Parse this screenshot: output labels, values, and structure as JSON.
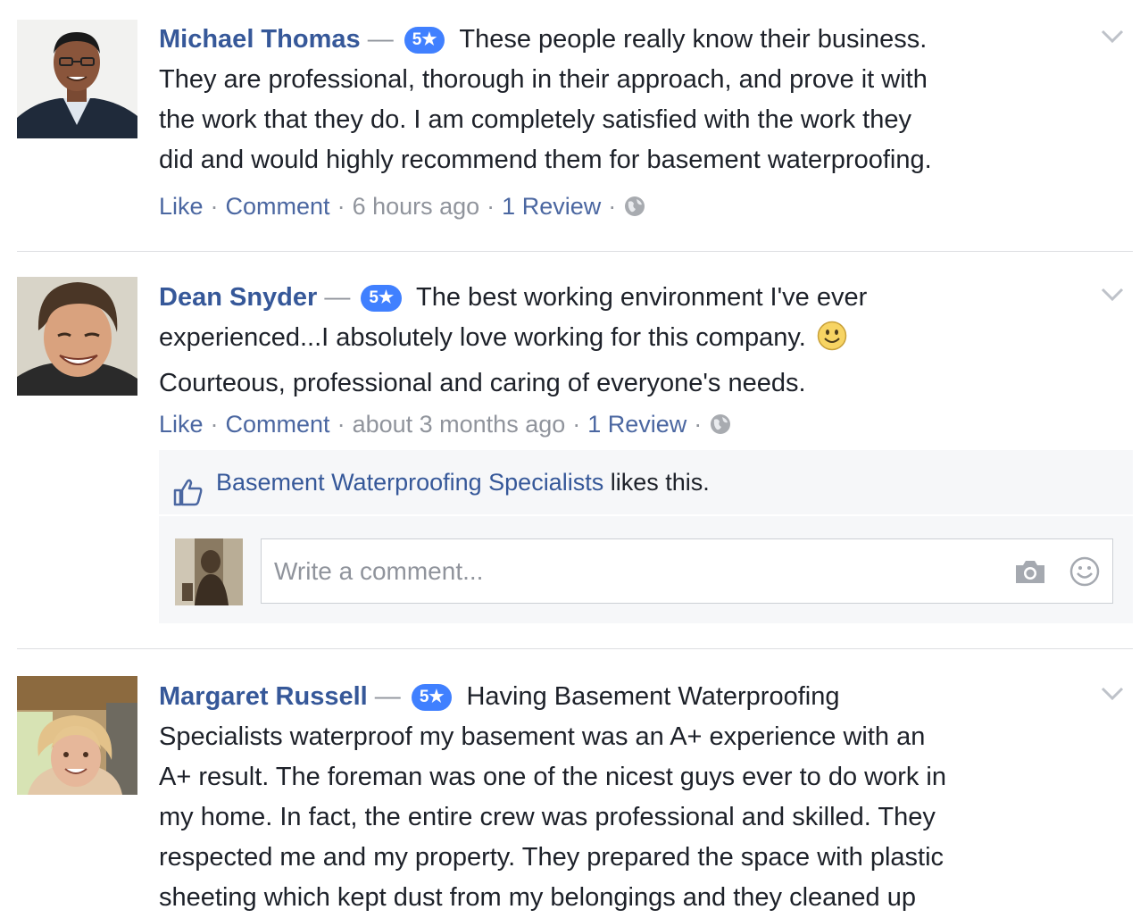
{
  "reviews": [
    {
      "name": "Michael Thomas",
      "dash": "—",
      "rating": "5★",
      "text_lines": [
        "These people really know their business.",
        "They are professional, thorough in their approach, and prove it with",
        "the work that they do. I am completely satisfied with the work they",
        "did and would highly recommend them for basement waterproofing."
      ],
      "like_label": "Like",
      "comment_label": "Comment",
      "time": "6 hours ago",
      "review_count": "1 Review"
    },
    {
      "name": "Dean Snyder",
      "dash": "—",
      "rating": "5★",
      "text_lines": [
        "The best working environment I've ever",
        "experienced...I absolutely love working for this company.",
        "Courteous, professional and caring of everyone's needs."
      ],
      "like_label": "Like",
      "comment_label": "Comment",
      "time": "about 3 months ago",
      "review_count": "1 Review",
      "likes": {
        "page_name": "Basement Waterproofing Specialists",
        "suffix": "likes this."
      },
      "comment_placeholder": "Write a comment..."
    },
    {
      "name": "Margaret Russell",
      "dash": "—",
      "rating": "5★",
      "text_lines": [
        "Having Basement Waterproofing",
        "Specialists waterproof my basement was an A+ experience with an",
        "A+ result. The foreman was one of the nicest guys ever to do work in",
        "my home. In fact, the entire crew was professional and skilled. They",
        "respected me and my property. They prepared the space with plastic",
        "sheeting which kept dust from my belongings and they cleaned up"
      ]
    }
  ],
  "meta_separator": "·",
  "colors": {
    "link": "#365899",
    "badge": "#4080ff",
    "meta": "#90949c",
    "divider": "#dddfe2"
  },
  "icons": {
    "globe": "globe-icon",
    "chevron": "chevron-down-icon",
    "thumb": "thumbs-up-icon",
    "camera": "camera-icon",
    "smiley": "smiley-icon",
    "emoji": "smiling-face-emoji"
  }
}
